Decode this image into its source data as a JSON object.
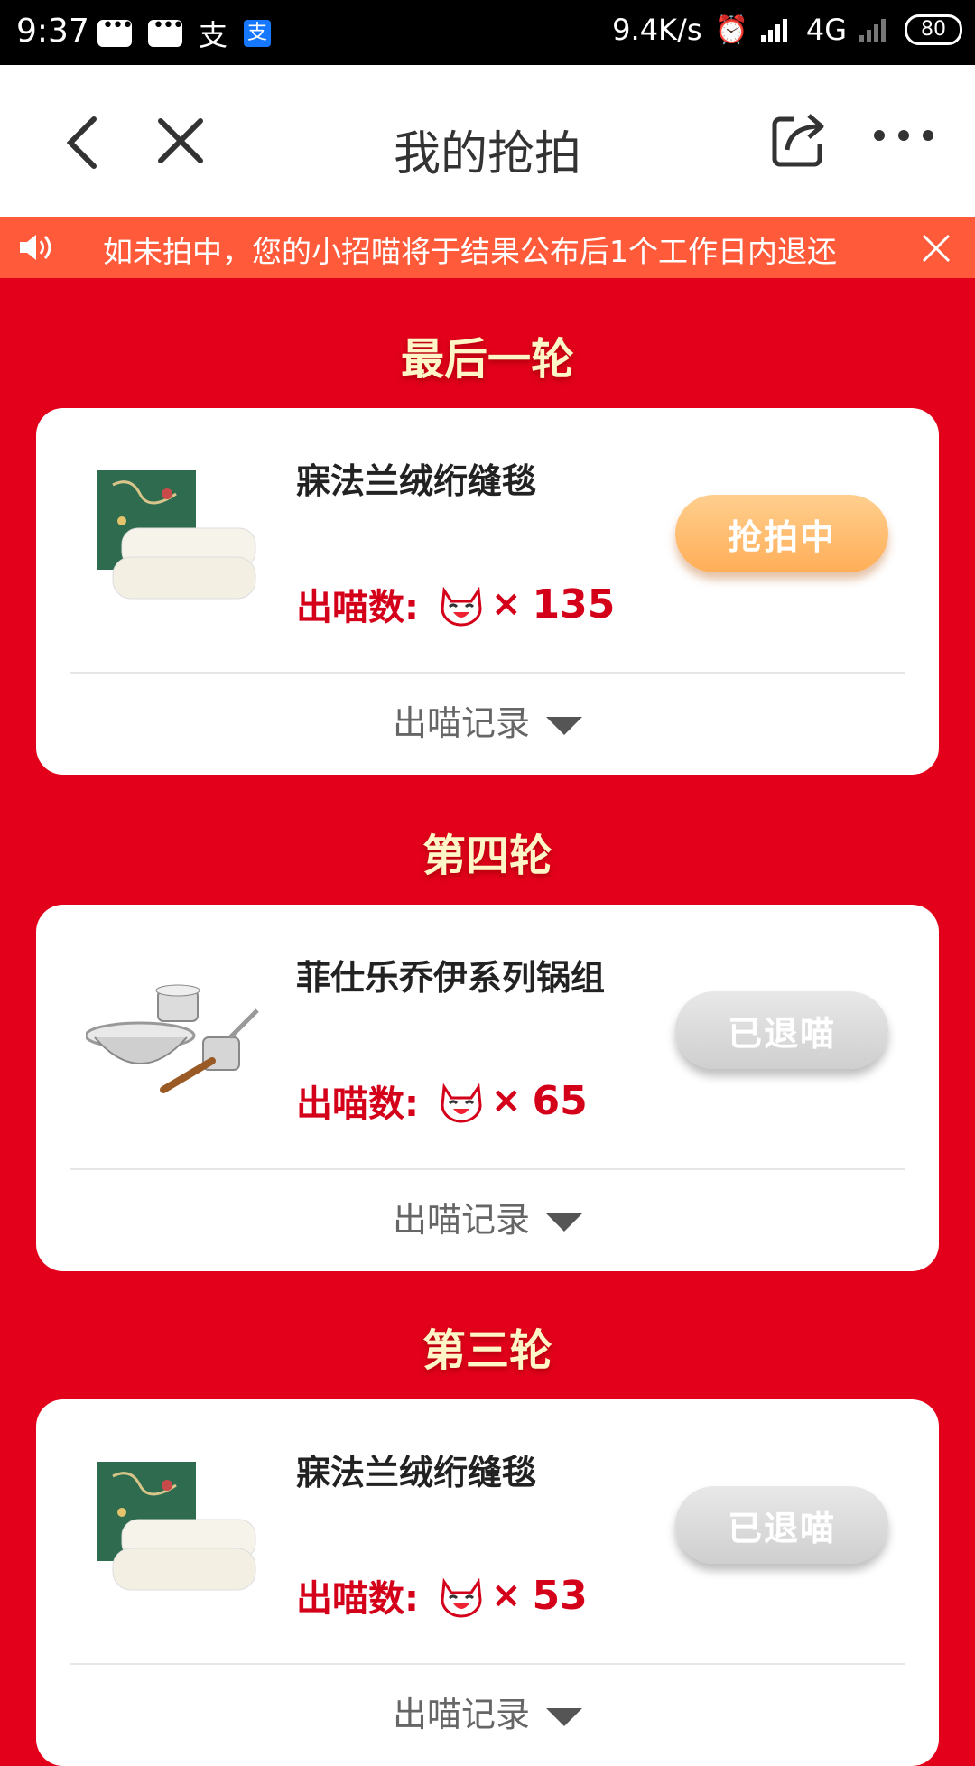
{
  "status_bar": {
    "time": "9:37",
    "speed": "9.4K/s",
    "network": "4G",
    "battery": "80"
  },
  "nav": {
    "title": "我的抢拍"
  },
  "notice": {
    "text": "如未拍中，您的小招喵将于结果公布后1个工作日内退还"
  },
  "rounds": [
    {
      "title": "最后一轮",
      "item_name": "寐法兰绒绗缝毯",
      "bid_label": "出喵数:",
      "bid_multiplier": "×",
      "bid_count": "135",
      "status_button": "抢拍中",
      "record_label": "出喵记录",
      "image": "blanket"
    },
    {
      "title": "第四轮",
      "item_name": "菲仕乐乔伊系列锅组",
      "bid_label": "出喵数:",
      "bid_multiplier": "×",
      "bid_count": "65",
      "status_button": "已退喵",
      "record_label": "出喵记录",
      "image": "cookware"
    },
    {
      "title": "第三轮",
      "item_name": "寐法兰绒绗缝毯",
      "bid_label": "出喵数:",
      "bid_multiplier": "×",
      "bid_count": "53",
      "status_button": "已退喵",
      "record_label": "出喵记录",
      "image": "blanket"
    }
  ],
  "colors": {
    "background": "#e2001a",
    "notice_bg": "#ff5a3a",
    "round_title": "#fff6c8",
    "bid_text": "#d4001a"
  }
}
